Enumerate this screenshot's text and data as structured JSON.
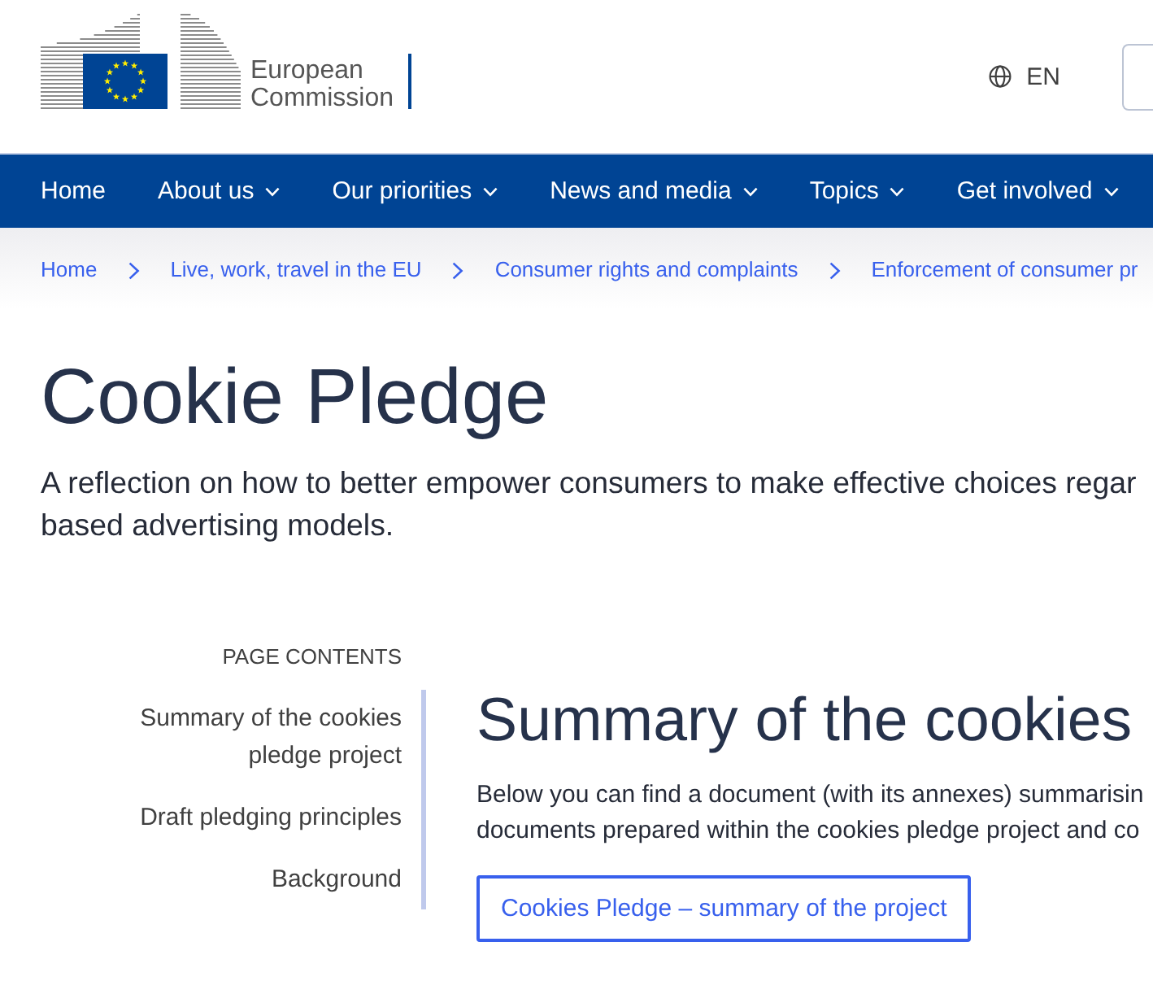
{
  "header": {
    "logo_lines": [
      "European",
      "Commission"
    ],
    "language": "EN"
  },
  "nav": [
    {
      "label": "Home",
      "has_menu": false
    },
    {
      "label": "About us",
      "has_menu": true
    },
    {
      "label": "Our priorities",
      "has_menu": true
    },
    {
      "label": "News and media",
      "has_menu": true
    },
    {
      "label": "Topics",
      "has_menu": true
    },
    {
      "label": "Get involved",
      "has_menu": true
    }
  ],
  "breadcrumb": [
    "Home",
    "Live, work, travel in the EU",
    "Consumer rights and complaints",
    "Enforcement of consumer pr"
  ],
  "page_title": "Cookie Pledge",
  "intro_lines": [
    "A reflection on how to better empower consumers to make effective choices regar",
    "based advertising models."
  ],
  "page_contents": {
    "heading": "PAGE CONTENTS",
    "items": [
      "Summary of the cookies pledge project",
      "Draft pledging principles",
      "Background"
    ]
  },
  "section": {
    "heading": "Summary of the cookies",
    "text_lines": [
      "Below you can find a document (with its annexes) summarisin",
      "documents prepared within the cookies pledge project and co"
    ],
    "button": "Cookies Pledge – summary of the project"
  }
}
